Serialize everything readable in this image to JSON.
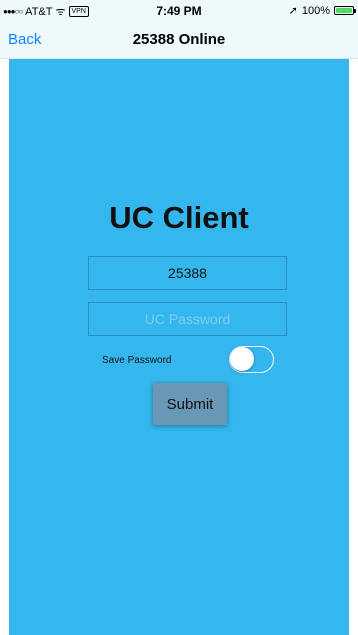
{
  "status_bar": {
    "signal": "●●●○○",
    "carrier": "AT&T",
    "wifi_icon": "wifi-icon",
    "wifi_glyph": "ᯤ",
    "vpn": "VPN",
    "time": "7:49 PM",
    "location_glyph": "➚",
    "battery_percent": "100%",
    "battery_level": 1.0,
    "battery_color": "#4cd964"
  },
  "nav": {
    "back_label": "Back",
    "title": "25388 Online"
  },
  "login": {
    "app_title": "UC Client",
    "username_value": "25388",
    "password_value": "",
    "password_placeholder": "UC Password",
    "save_password_label": "Save Password",
    "save_password_on": false,
    "submit_label": "Submit"
  },
  "colors": {
    "background": "#34b7ee",
    "nav_background": "#eef9fc",
    "accent": "#0a84ff",
    "submit_background": "#6898b6"
  }
}
